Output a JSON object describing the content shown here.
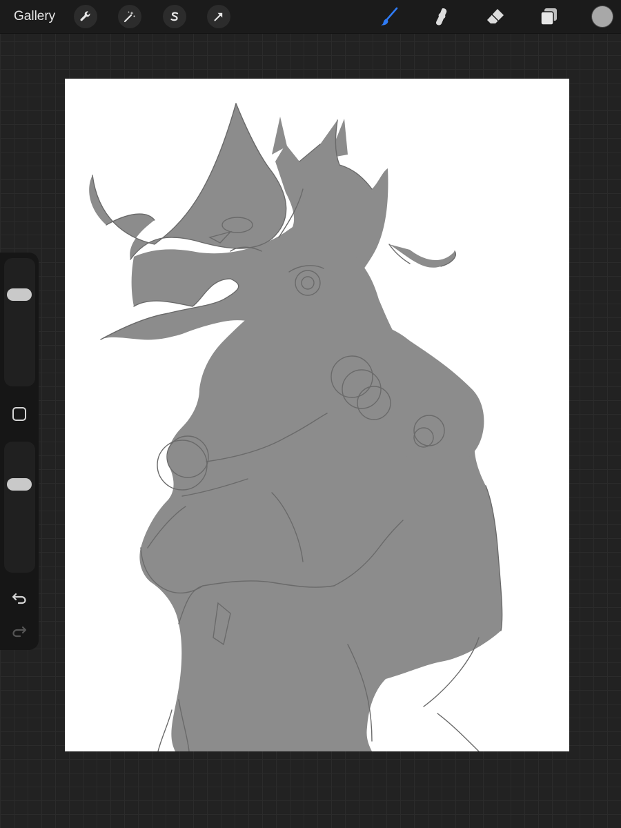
{
  "toolbar": {
    "gallery_label": "Gallery",
    "left_tools": [
      {
        "icon": "wrench-icon",
        "name": "actions"
      },
      {
        "icon": "magic-wand-icon",
        "name": "adjustments"
      },
      {
        "icon": "selection-s-icon",
        "name": "selection"
      },
      {
        "icon": "arrow-cursor-icon",
        "name": "transform"
      }
    ],
    "right_tools": [
      {
        "icon": "brush-icon",
        "name": "brush",
        "active": true
      },
      {
        "icon": "smudge-icon",
        "name": "smudge",
        "active": false
      },
      {
        "icon": "eraser-icon",
        "name": "eraser",
        "active": false
      },
      {
        "icon": "layers-icon",
        "name": "layers",
        "active": false
      }
    ],
    "active_color": "#a8a8a8",
    "accent_color": "#2f7bf5"
  },
  "sidebar": {
    "brush_size": 0.75,
    "opacity": 0.7
  },
  "canvas": {
    "background": "#ffffff",
    "fill_color": "#8c8c8c",
    "line_color": "#6a6a6a"
  }
}
